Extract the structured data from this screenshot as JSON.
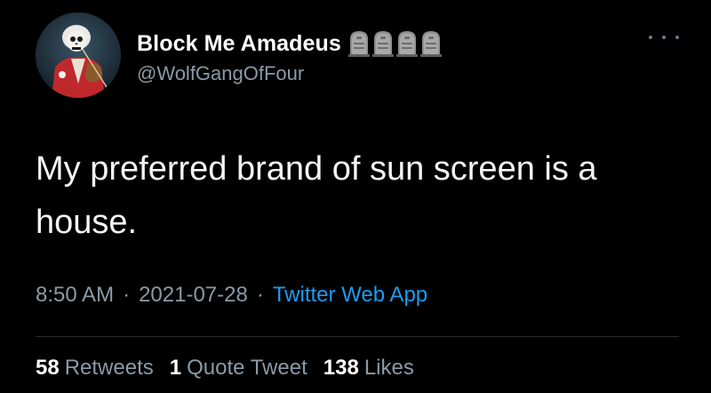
{
  "user": {
    "display_name": "Block Me Amadeus",
    "handle": "@WolfGangOfFour",
    "avatar_icon": "skeleton-composer-avatar",
    "badges": [
      "tombstone-icon",
      "tombstone-icon",
      "tombstone-icon",
      "tombstone-icon"
    ]
  },
  "tweet": {
    "text": "My preferred brand of sun screen is a house.",
    "time": "8:50 AM",
    "date": "2021-07-28",
    "separator": "·",
    "source": "Twitter Web App"
  },
  "stats": {
    "retweets_count": "58",
    "retweets_label": "Retweets",
    "quotes_count": "1",
    "quotes_label": "Quote Tweet",
    "likes_count": "138",
    "likes_label": "Likes"
  },
  "colors": {
    "background": "#000000",
    "text": "#f2f4f5",
    "secondary": "#8b9aa6",
    "link": "#1d9bf0"
  }
}
